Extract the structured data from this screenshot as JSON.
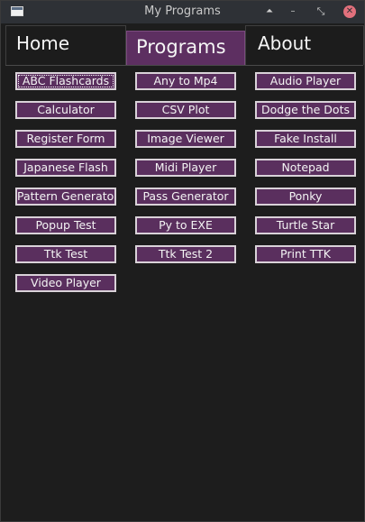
{
  "window": {
    "title": "My Programs",
    "controls": {
      "up": "⏶",
      "minimize": "–",
      "maximize": "⤡",
      "close": "✕"
    }
  },
  "tabs": [
    {
      "label": "Home"
    },
    {
      "label": "Programs"
    },
    {
      "label": "About"
    }
  ],
  "programs": {
    "col1": [
      "ABC Flashcards",
      "Calculator",
      "Register Form",
      "Japanese Flash",
      "Pattern Generator",
      "Popup Test",
      "Ttk Test",
      "Video Player"
    ],
    "col2": [
      "Any to Mp4",
      "CSV Plot",
      "Image Viewer",
      "Midi Player",
      "Pass Generator",
      "Py to EXE",
      "Ttk Test 2"
    ],
    "col3": [
      "Audio Player",
      "Dodge the Dots",
      "Fake Install",
      "Notepad",
      "Ponky",
      "Turtle Star",
      "Print TTK"
    ]
  },
  "colors": {
    "button_bg": "#5a2f5e",
    "active_tab_bg": "#5d2f61",
    "content_bg": "#1d1d1d",
    "titlebar_bg": "#2e3136",
    "close_button": "#e2707c"
  }
}
